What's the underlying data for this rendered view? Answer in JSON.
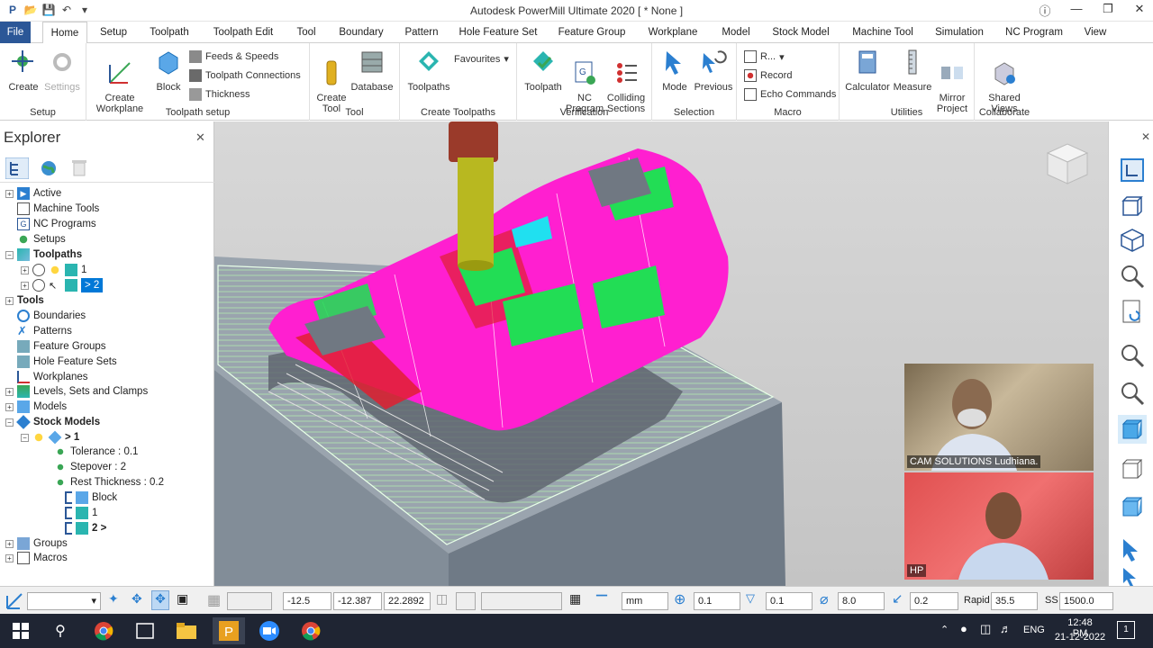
{
  "window": {
    "title": "Autodesk PowerMill Ultimate 2020   [ * None ]"
  },
  "tabs": [
    "File",
    "Home",
    "Setup",
    "Toolpath",
    "Toolpath Edit",
    "Tool",
    "Boundary",
    "Pattern",
    "Hole Feature Set",
    "Feature Group",
    "Workplane",
    "Model",
    "Stock Model",
    "Machine Tool",
    "Simulation",
    "NC Program",
    "View"
  ],
  "ribbon": {
    "setup": {
      "label": "Setup",
      "create": "Create",
      "settings": "Settings"
    },
    "toolpath_setup": {
      "label": "Toolpath setup",
      "create_workplane": "Create\nWorkplane",
      "block": "Block",
      "feeds": "Feeds & Speeds",
      "connections": "Toolpath Connections",
      "thickness": "Thickness"
    },
    "tool": {
      "label": "Tool",
      "create_tool": "Create\nTool",
      "database": "Database"
    },
    "create_toolpaths": {
      "label": "Create Toolpaths",
      "toolpaths": "Toolpaths",
      "favourites": "Favourites"
    },
    "verification": {
      "label": "Verification",
      "toolpath": "Toolpath",
      "nc_program": "NC\nProgram",
      "colliding": "Colliding\nSections"
    },
    "selection": {
      "label": "Selection",
      "mode": "Mode",
      "previous": "Previous"
    },
    "macro": {
      "label": "Macro",
      "run": "R...",
      "record": "Record",
      "echo": "Echo Commands"
    },
    "utilities": {
      "label": "Utilities",
      "calculator": "Calculator",
      "measure": "Measure",
      "mirror": "Mirror\nProject"
    },
    "collaborate": {
      "label": "Collaborate",
      "shared": "Shared\nViews"
    }
  },
  "explorer": {
    "title": "Explorer",
    "items": {
      "active": "Active",
      "machine_tools": "Machine Tools",
      "nc_programs": "NC Programs",
      "setups": "Setups",
      "toolpaths": "Toolpaths",
      "tp1": "1",
      "tp2": "> 2",
      "tools": "Tools",
      "boundaries": "Boundaries",
      "patterns": "Patterns",
      "feature_groups": "Feature Groups",
      "hole_feature_sets": "Hole Feature Sets",
      "workplanes": "Workplanes",
      "levels": "Levels, Sets and Clamps",
      "models": "Models",
      "stock_models": "Stock Models",
      "sm1": "> 1",
      "tolerance": "Tolerance : 0.1",
      "stepover": "Stepover : 2",
      "rest": "Rest Thickness : 0.2",
      "block": "Block",
      "ref1": "1",
      "ref2": "2 >",
      "groups": "Groups",
      "macros": "Macros"
    }
  },
  "cams": {
    "top": "CAM SOLUTIONS Ludhiana.",
    "bottom": "HP"
  },
  "status": {
    "x": "-12.5",
    "y": "-12.387",
    "z": "22.2892",
    "units": "mm",
    "tol": "0.1",
    "thick": "0.1",
    "dia": "8.0",
    "step": "0.2",
    "rapid_label": "Rapid",
    "rapid": "35.5",
    "ss_label": "SS",
    "ss": "1500.0"
  },
  "taskbar": {
    "time": "12:48 PM",
    "date": "21-12-2022",
    "lang": "ENG",
    "notif": "1"
  },
  "colors": {
    "accent": "#2b5797",
    "toolpath": "#ff1fd0",
    "selected": "#0078d7"
  }
}
